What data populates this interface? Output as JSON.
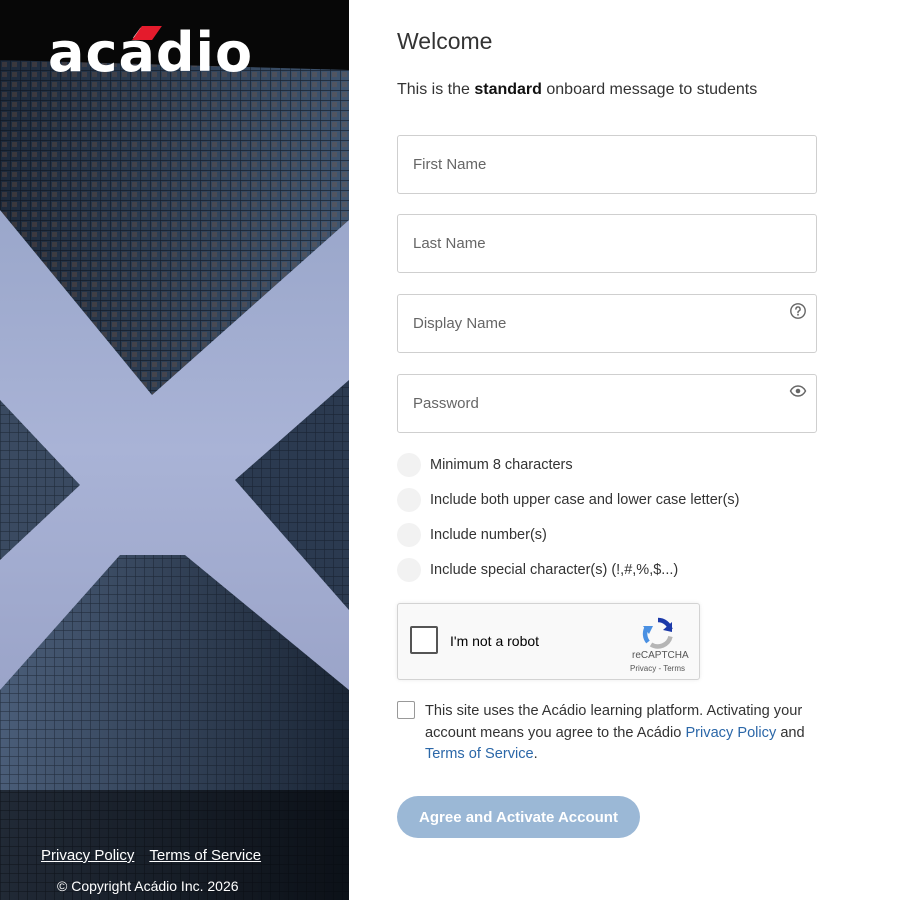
{
  "brand": {
    "logo_text": "acádio",
    "accent_color": "#e41b2c"
  },
  "left_footer": {
    "privacy_label": "Privacy Policy",
    "terms_label": "Terms of Service",
    "copyright": "© Copyright Acádio Inc. 2026"
  },
  "form": {
    "title": "Welcome",
    "message_prefix": "This is the ",
    "message_bold": "standard",
    "message_suffix": " onboard message to students",
    "fields": {
      "first_name": {
        "placeholder": "First Name",
        "value": ""
      },
      "last_name": {
        "placeholder": "Last Name",
        "value": ""
      },
      "display_name": {
        "placeholder": "Display Name",
        "value": "",
        "icon": "help-circle-icon"
      },
      "password": {
        "placeholder": "Password",
        "value": "",
        "icon": "eye-icon"
      }
    },
    "requirements": [
      "Minimum 8 characters",
      "Include both upper case and lower case letter(s)",
      "Include number(s)",
      "Include special character(s) (!,#,%,$...)"
    ],
    "recaptcha": {
      "label": "I'm not a robot",
      "brand": "reCAPTCHA",
      "privacy": "Privacy",
      "separator": " - ",
      "terms": "Terms"
    },
    "agreement": {
      "text_before": "This site uses the Acádio learning platform. Activating your account means you agree to the Acádio ",
      "privacy_link": "Privacy Policy",
      "text_middle": " and ",
      "terms_link": "Terms of Service",
      "text_after": "."
    },
    "submit_label": "Agree and Activate Account",
    "button_color": "#9bb8d6",
    "link_color": "#2b67a8"
  }
}
